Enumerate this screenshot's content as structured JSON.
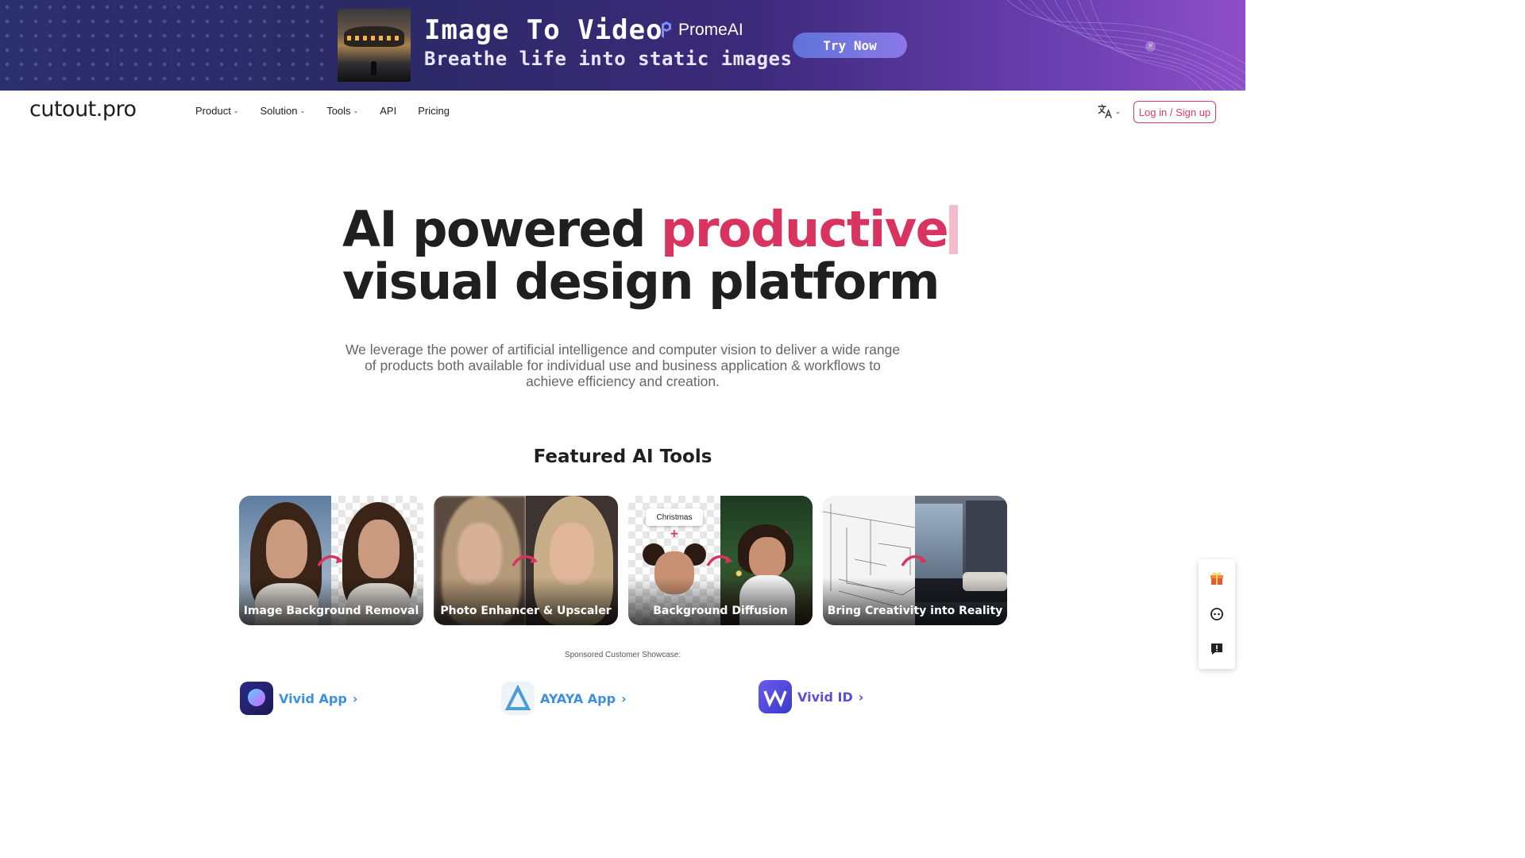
{
  "banner": {
    "title": "Image To Video",
    "subtitle": "Breathe life into static images",
    "brand": "PromeAI",
    "cta": "Try Now",
    "close_icon": "×"
  },
  "nav": {
    "brand": "cutout.pro",
    "items": [
      {
        "label": "Product",
        "has_dropdown": true
      },
      {
        "label": "Solution",
        "has_dropdown": true
      },
      {
        "label": "Tools",
        "has_dropdown": true
      },
      {
        "label": "API",
        "has_dropdown": false
      },
      {
        "label": "Pricing",
        "has_dropdown": false
      }
    ],
    "chevron": "⌄",
    "language_icon": "translate-icon",
    "login": "Log in / Sign up"
  },
  "hero": {
    "line1_prefix": "AI powered ",
    "line1_accent": "productive",
    "line2": "visual design platform",
    "description": "We leverage the power of artificial intelligence and computer vision to deliver a wide range of products both available for individual use and business application & workflows to achieve efficiency and creation."
  },
  "featured": {
    "title": "Featured AI Tools",
    "cards": [
      {
        "label": "Image Background Removal"
      },
      {
        "label": "Photo Enhancer & Upscaler"
      },
      {
        "label": "Background Diffusion",
        "tag": "Christmas",
        "plus": "+"
      },
      {
        "label": "Bring Creativity into Reality"
      }
    ]
  },
  "sponsored": {
    "label": "Sponsored Customer Showcase:",
    "apps": [
      {
        "name": "Vivid App",
        "arrow": "›",
        "color": "#3d8fe0"
      },
      {
        "name": "AYAYA App",
        "arrow": "›",
        "color": "#3d8fe0"
      },
      {
        "name": "Vivid ID",
        "arrow": "›",
        "color": "#5a4fd8"
      }
    ]
  },
  "floating": {
    "icons": [
      "gift-icon",
      "robot-icon",
      "feedback-icon"
    ]
  },
  "colors": {
    "accent": "#d8345f",
    "banner_start": "#2c2f6e",
    "banner_end": "#8e4fc8"
  }
}
